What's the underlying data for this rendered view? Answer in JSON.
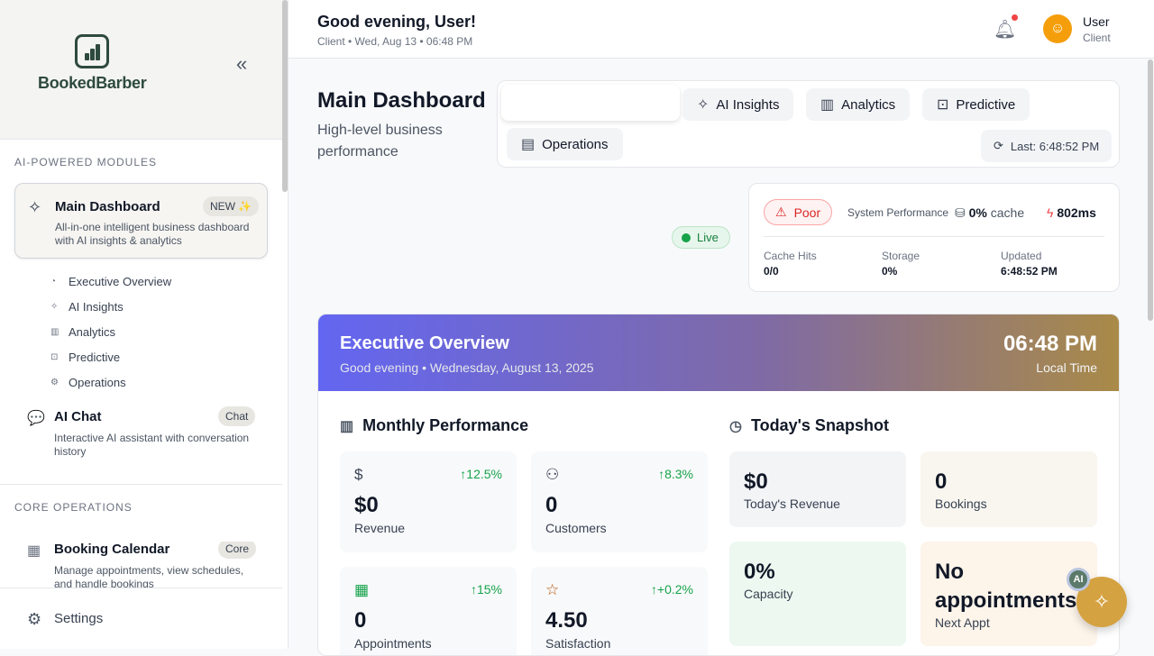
{
  "sidebar": {
    "brand": "BookedBarber",
    "sections": {
      "ai": "AI-POWERED MODULES",
      "core": "CORE OPERATIONS"
    },
    "main_card": {
      "title": "Main Dashboard",
      "badge": "NEW ✨",
      "desc": "All-in-one intelligent business dashboard with AI insights & analytics"
    },
    "sub_items": [
      "Executive Overview",
      "AI Insights",
      "Analytics",
      "Predictive",
      "Operations"
    ],
    "ai_chat": {
      "title": "AI Chat",
      "badge": "Chat",
      "desc": "Interactive AI assistant with conversation history"
    },
    "booking": {
      "title": "Booking Calendar",
      "badge": "Core",
      "desc": "Manage appointments, view schedules, and handle bookings"
    },
    "settings": "Settings"
  },
  "header": {
    "greeting": "Good evening, User!",
    "subline": "Client • Wed, Aug 13 • 06:48 PM",
    "user_name": "User",
    "user_role": "Client"
  },
  "page": {
    "title": "Main Dashboard",
    "subtitle": "High-level business performance"
  },
  "tabs": {
    "ai_insights": "AI Insights",
    "analytics": "Analytics",
    "predictive": "Predictive",
    "operations": "Operations",
    "last_updated": "Last: 6:48:52 PM"
  },
  "status": {
    "live": "Live",
    "poor": "Poor",
    "system_performance": "System Performance",
    "cache_value": "0%",
    "cache_label": "cache",
    "latency": "802ms",
    "cache_hits_label": "Cache Hits",
    "cache_hits_value": "0/0",
    "storage_label": "Storage",
    "storage_value": "0%",
    "updated_label": "Updated",
    "updated_value": "6:48:52 PM"
  },
  "executive": {
    "title": "Executive Overview",
    "subtitle": "Good evening • Wednesday, August 13, 2025",
    "time": "06:48 PM",
    "time_label": "Local Time",
    "monthly_title": "Monthly Performance",
    "snapshot_title": "Today's Snapshot",
    "metrics": [
      {
        "value": "$0",
        "label": "Revenue",
        "change": "↑12.5%"
      },
      {
        "value": "0",
        "label": "Customers",
        "change": "↑8.3%"
      },
      {
        "value": "0",
        "label": "Appointments",
        "change": "↑15%"
      },
      {
        "value": "4.50",
        "label": "Satisfaction",
        "change": "↑+0.2%"
      }
    ],
    "snapshot": [
      {
        "value": "$0",
        "label": "Today's Revenue"
      },
      {
        "value": "0",
        "label": "Bookings"
      },
      {
        "value": "0%",
        "label": "Capacity"
      },
      {
        "value": "No appointments",
        "label": "Next Appt"
      }
    ]
  },
  "fab": {
    "badge": "AI"
  }
}
